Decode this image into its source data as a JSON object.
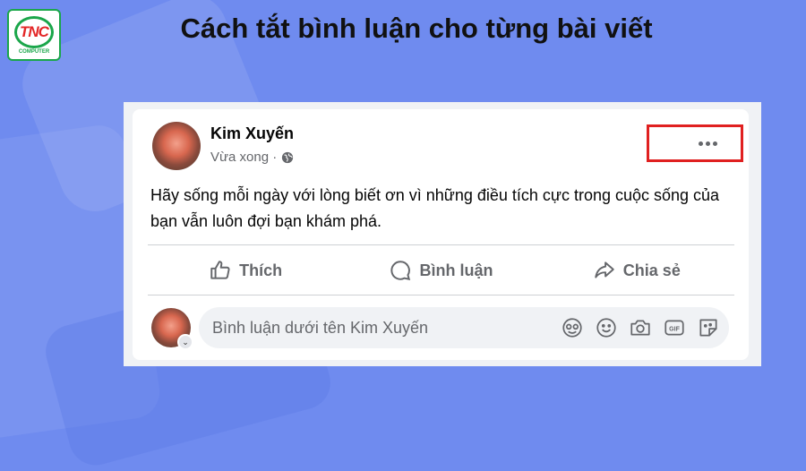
{
  "logo": {
    "main": "TNC",
    "sub": "COMPUTER"
  },
  "title": "Cách tắt bình luận cho từng bài viết",
  "post": {
    "author": "Kim Xuyến",
    "time": "Vừa xong ·",
    "text": "Hãy sống mỗi ngày với lòng biết ơn vì những điều tích cực trong cuộc sống của bạn vẫn luôn đợi bạn khám phá.",
    "actions": [
      {
        "label": "Thích",
        "icon": "like-icon"
      },
      {
        "label": "Bình luận",
        "icon": "comment-icon"
      },
      {
        "label": "Chia sẻ",
        "icon": "share-icon"
      }
    ],
    "comment_placeholder": "Bình luận dưới tên Kim Xuyến",
    "comment_tools": [
      "avatar-sticker-icon",
      "emoji-icon",
      "camera-icon",
      "gif-icon",
      "sticker-icon"
    ]
  },
  "colors": {
    "background": "#6f8bef",
    "highlight": "#e02020",
    "muted": "#65676b"
  }
}
